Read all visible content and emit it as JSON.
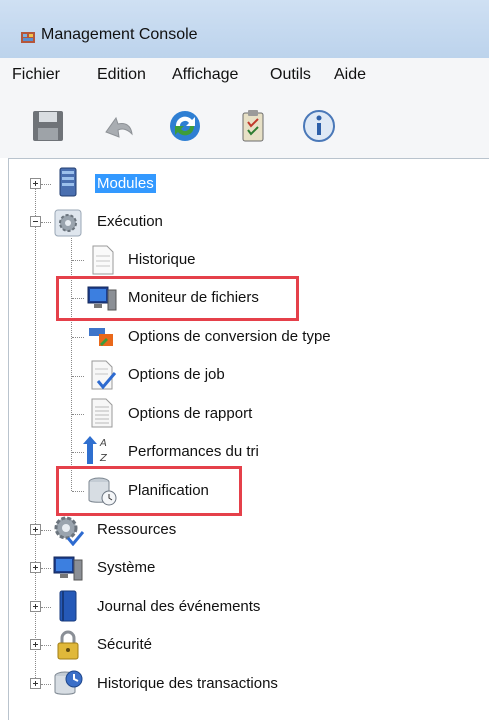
{
  "window": {
    "title": "Management Console"
  },
  "menu": [
    "Fichier",
    "Edition",
    "Affichage",
    "Outils",
    "Aide"
  ],
  "toolbar": {
    "buttons": [
      {
        "icon": "save-icon"
      },
      {
        "icon": "undo-icon"
      },
      {
        "icon": "refresh-icon"
      },
      {
        "icon": "clipboard-icon"
      },
      {
        "icon": "info-icon"
      }
    ]
  },
  "tree": {
    "modules": "Modules",
    "execution": "Exécution",
    "children": [
      "Historique",
      "Moniteur de fichiers",
      "Options de conversion de type",
      "Options de job",
      "Options de rapport",
      "Performances du tri",
      "Planification"
    ],
    "roots_after": [
      "Ressources",
      "Système",
      "Journal des événements",
      "Sécurité",
      "Historique des transactions"
    ]
  },
  "highlight_color": "#e5404a",
  "selection_color": "#3399ff"
}
